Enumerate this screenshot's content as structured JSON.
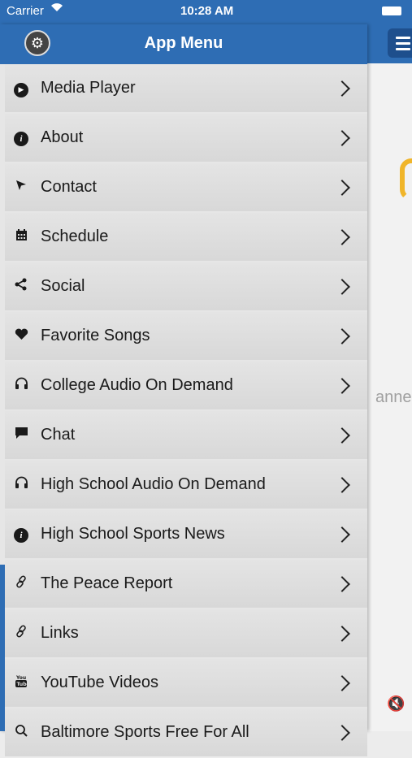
{
  "status_bar": {
    "carrier": "Carrier",
    "time": "10:28 AM"
  },
  "header": {
    "title": "App Menu"
  },
  "menu_items": [
    {
      "label": "Media Player",
      "icon": "play-circle-icon"
    },
    {
      "label": "About",
      "icon": "info-icon"
    },
    {
      "label": "Contact",
      "icon": "cursor-arrow-icon"
    },
    {
      "label": "Schedule",
      "icon": "calendar-icon"
    },
    {
      "label": "Social",
      "icon": "share-icon"
    },
    {
      "label": "Favorite Songs",
      "icon": "heart-icon"
    },
    {
      "label": "College Audio On Demand",
      "icon": "headphones-icon"
    },
    {
      "label": "Chat",
      "icon": "chat-bubble-icon"
    },
    {
      "label": "High School Audio On Demand",
      "icon": "headphones-icon"
    },
    {
      "label": "High School Sports News",
      "icon": "info-icon"
    },
    {
      "label": "The Peace Report",
      "icon": "link-icon"
    },
    {
      "label": "Links",
      "icon": "link-icon"
    },
    {
      "label": "YouTube Videos",
      "icon": "youtube-icon"
    },
    {
      "label": "Baltimore Sports Free For All",
      "icon": "search-icon"
    }
  ],
  "background_peek_text": "anne",
  "colors": {
    "header": "#2e6db4",
    "item_bg": "#dcdcdc",
    "accent": "#2e6db4",
    "logo_yellow": "#f0b52a"
  }
}
